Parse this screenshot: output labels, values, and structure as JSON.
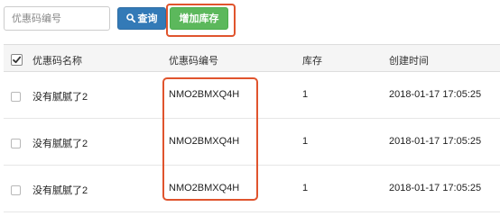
{
  "toolbar": {
    "search_placeholder": "优惠码编号",
    "search_button_label": "查询",
    "add_stock_button_label": "增加库存"
  },
  "table": {
    "columns": [
      "优惠码名称",
      "优惠码编号",
      "库存",
      "创建时间"
    ],
    "rows": [
      {
        "name": "没有腻腻了2",
        "code": "NMO2BMXQ4H",
        "stock": "1",
        "created": "2018-01-17 17:05:25"
      },
      {
        "name": "没有腻腻了2",
        "code": "NMO2BMXQ4H",
        "stock": "1",
        "created": "2018-01-17 17:05:25"
      },
      {
        "name": "没有腻腻了2",
        "code": "NMO2BMXQ4H",
        "stock": "1",
        "created": "2018-01-17 17:05:25"
      }
    ]
  },
  "colors": {
    "primary": "#337ab7",
    "success": "#5cb85c",
    "highlight": "#e0542d"
  }
}
